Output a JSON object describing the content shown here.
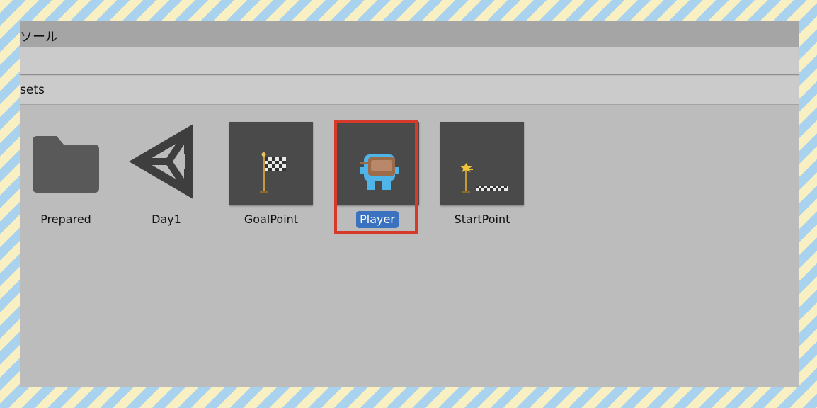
{
  "window": {
    "title": "ソール"
  },
  "breadcrumb": {
    "current": "sets"
  },
  "assets": [
    {
      "label": "Prepared",
      "icon": "folder-icon",
      "selected": false
    },
    {
      "label": "Day1",
      "icon": "unity-logo-icon",
      "selected": false
    },
    {
      "label": "GoalPoint",
      "icon": "goal-flag-icon",
      "selected": false
    },
    {
      "label": "Player",
      "icon": "player-sprite-icon",
      "selected": true
    },
    {
      "label": "StartPoint",
      "icon": "start-point-icon",
      "selected": false
    }
  ],
  "colors": {
    "selection": "#3a72c0",
    "highlight_box": "#d7392b",
    "thumb_bg": "#4a4a4a",
    "panel_bg": "#bcbcbc"
  }
}
